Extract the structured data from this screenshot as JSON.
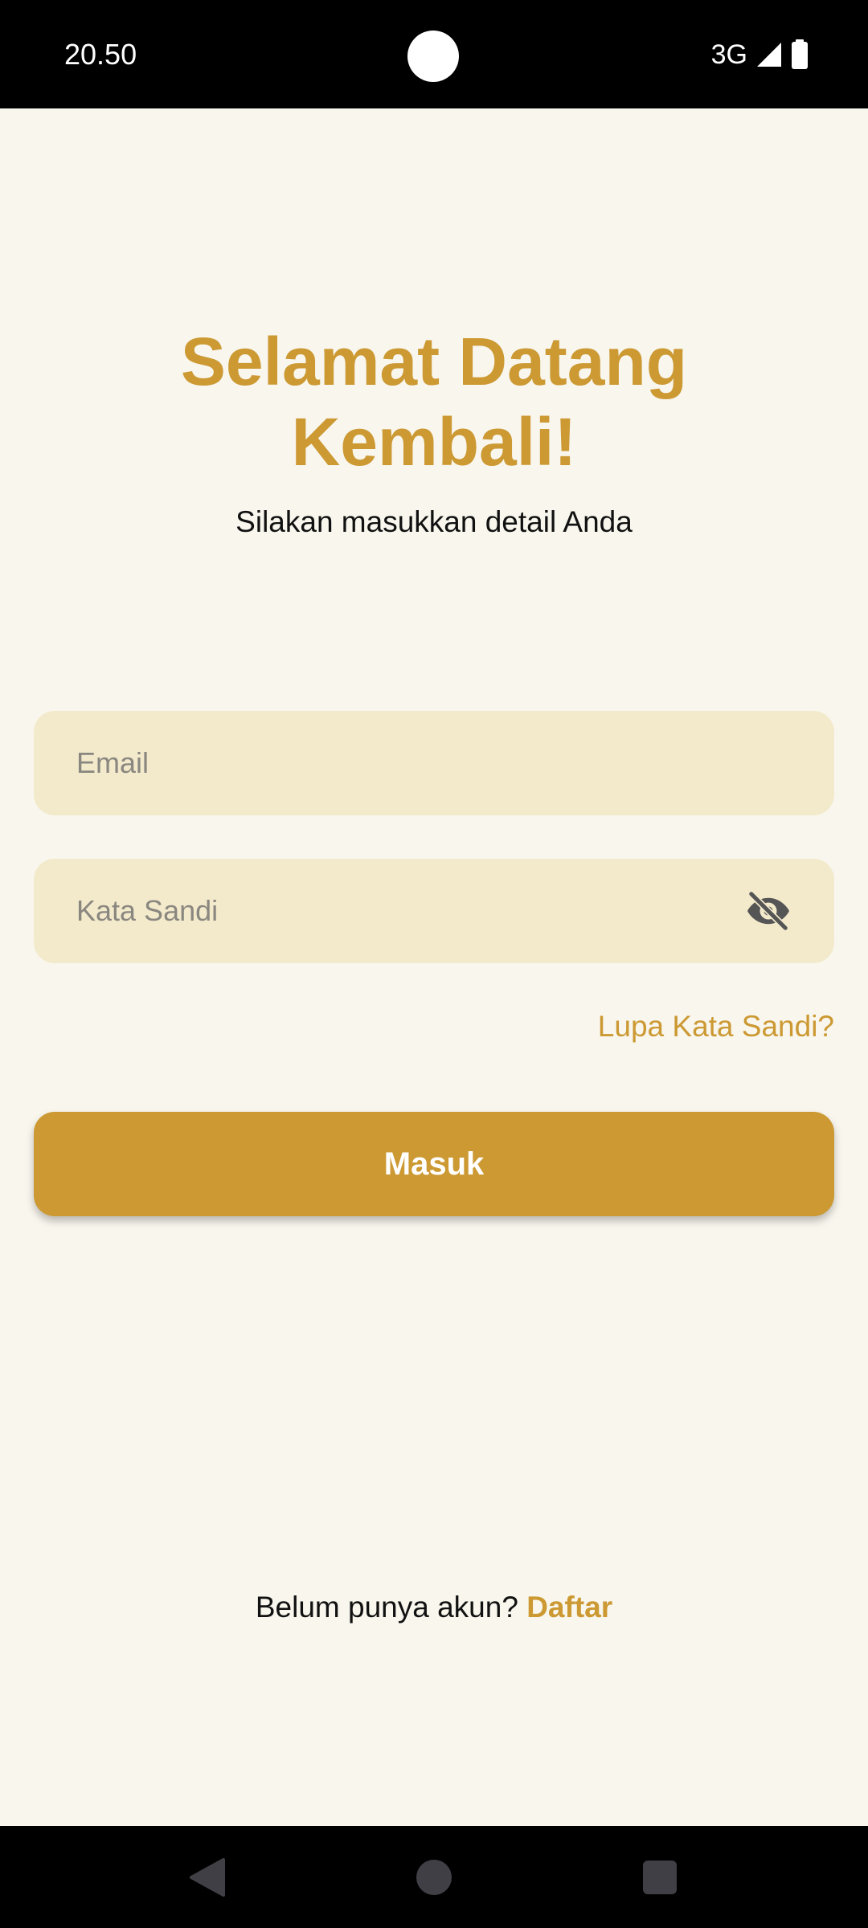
{
  "status_bar": {
    "time": "20.50",
    "network": "3G",
    "icons": [
      "signal-icon",
      "battery-icon"
    ]
  },
  "login": {
    "title": "Selamat Datang Kembali!",
    "subtitle": "Silakan masukkan detail Anda",
    "email": {
      "placeholder": "Email",
      "value": ""
    },
    "password": {
      "placeholder": "Kata Sandi",
      "value": "",
      "toggle_icon": "eye-off-icon"
    },
    "forgot_label": "Lupa Kata Sandi?",
    "submit_label": "Masuk",
    "signup_prompt": "Belum punya akun?",
    "signup_link": "Daftar"
  },
  "nav_bar": {
    "buttons": [
      "back-icon",
      "home-icon",
      "recents-icon"
    ]
  },
  "colors": {
    "accent": "#cc9933",
    "background": "#f8f6ed",
    "field": "#f3eacb"
  }
}
